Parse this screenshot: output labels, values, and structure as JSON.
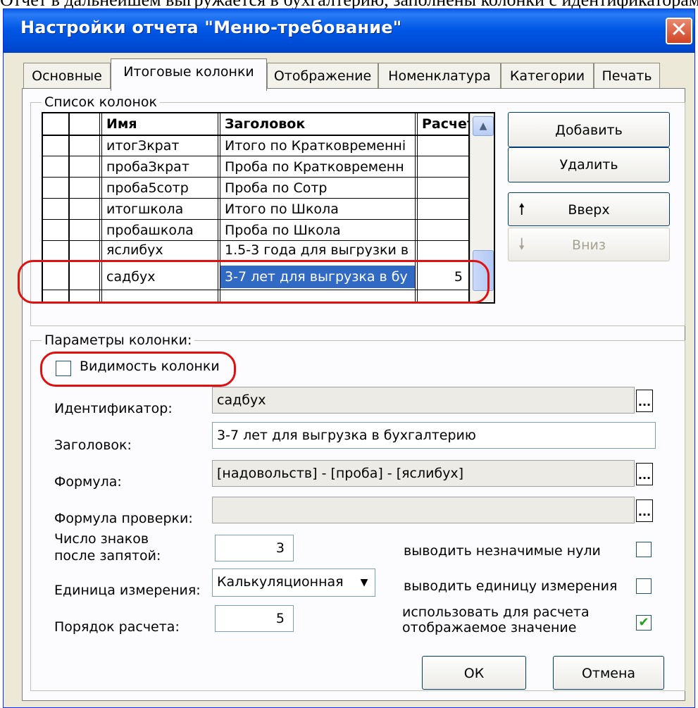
{
  "top_text": "Отчет в дальнейшем выгружается в бухгалтерию, заполнены колонки с идентификаторами",
  "window": {
    "title": "Настройки отчета \"Меню-требование\"",
    "close": "✕"
  },
  "tabs": [
    "Основные",
    "Итоговые колонки",
    "Отображение",
    "Номенклатура",
    "Категории",
    "Печать"
  ],
  "columns_group": {
    "legend": "Список колонок",
    "headers": [
      "Имя",
      "Заголовок",
      "Расчет"
    ],
    "rows": [
      [
        "итогЗкрат",
        "Итого по Кратковременні",
        ""
      ],
      [
        "пробаЗкрат",
        "Проба по Кратковременн",
        ""
      ],
      [
        "проба5сотр",
        "Проба по Сотр",
        ""
      ],
      [
        "итогшкола",
        "Итого по Школа",
        ""
      ],
      [
        "пробашкола",
        "Проба по Школа",
        ""
      ],
      [
        "яслибух",
        "1.5-3 года для выгрузки в",
        ""
      ],
      [
        "садбух",
        "3-7 лет для выгрузка в бу",
        "5"
      ]
    ],
    "buttons": {
      "add": "Добавить",
      "delete": "Удалить",
      "up": "Вверх",
      "down": "Вниз"
    }
  },
  "params_group": {
    "legend": "Параметры колонки:",
    "visibility_label": "Видимость колонки",
    "visibility_checked": false,
    "identifier_label": "Идентификатор:",
    "identifier_value": "садбух",
    "header_label": "Заголовок:",
    "header_value": "3-7 лет для выгрузка в бухгалтерию",
    "formula_label": "Формула:",
    "formula_value": "[надовольств]  - [проба] - [яслибух]",
    "check_formula_label": "Формула проверки:",
    "check_formula_value": "",
    "digits_label_1": "Число знаков",
    "digits_label_2": "после запятой:",
    "digits_value": "3",
    "unit_label": "Единица измерения:",
    "unit_value": "Калькуляционная",
    "order_label": "Порядок расчета:",
    "order_value": "5",
    "zeros_label": "выводить незначимые нули",
    "zeros_checked": false,
    "unit_show_label": "выводить единицу измерения",
    "unit_show_checked": false,
    "use_display_label_1": "использовать для расчета",
    "use_display_label_2": "отображаемое значение",
    "use_display_checked": true,
    "dots": "..."
  },
  "footer": {
    "ok": "ОК",
    "cancel": "Отмена"
  },
  "colors": {
    "selection": "#316ac5",
    "highlight_ring": "#e01010",
    "titlebar": "#0054e3"
  }
}
